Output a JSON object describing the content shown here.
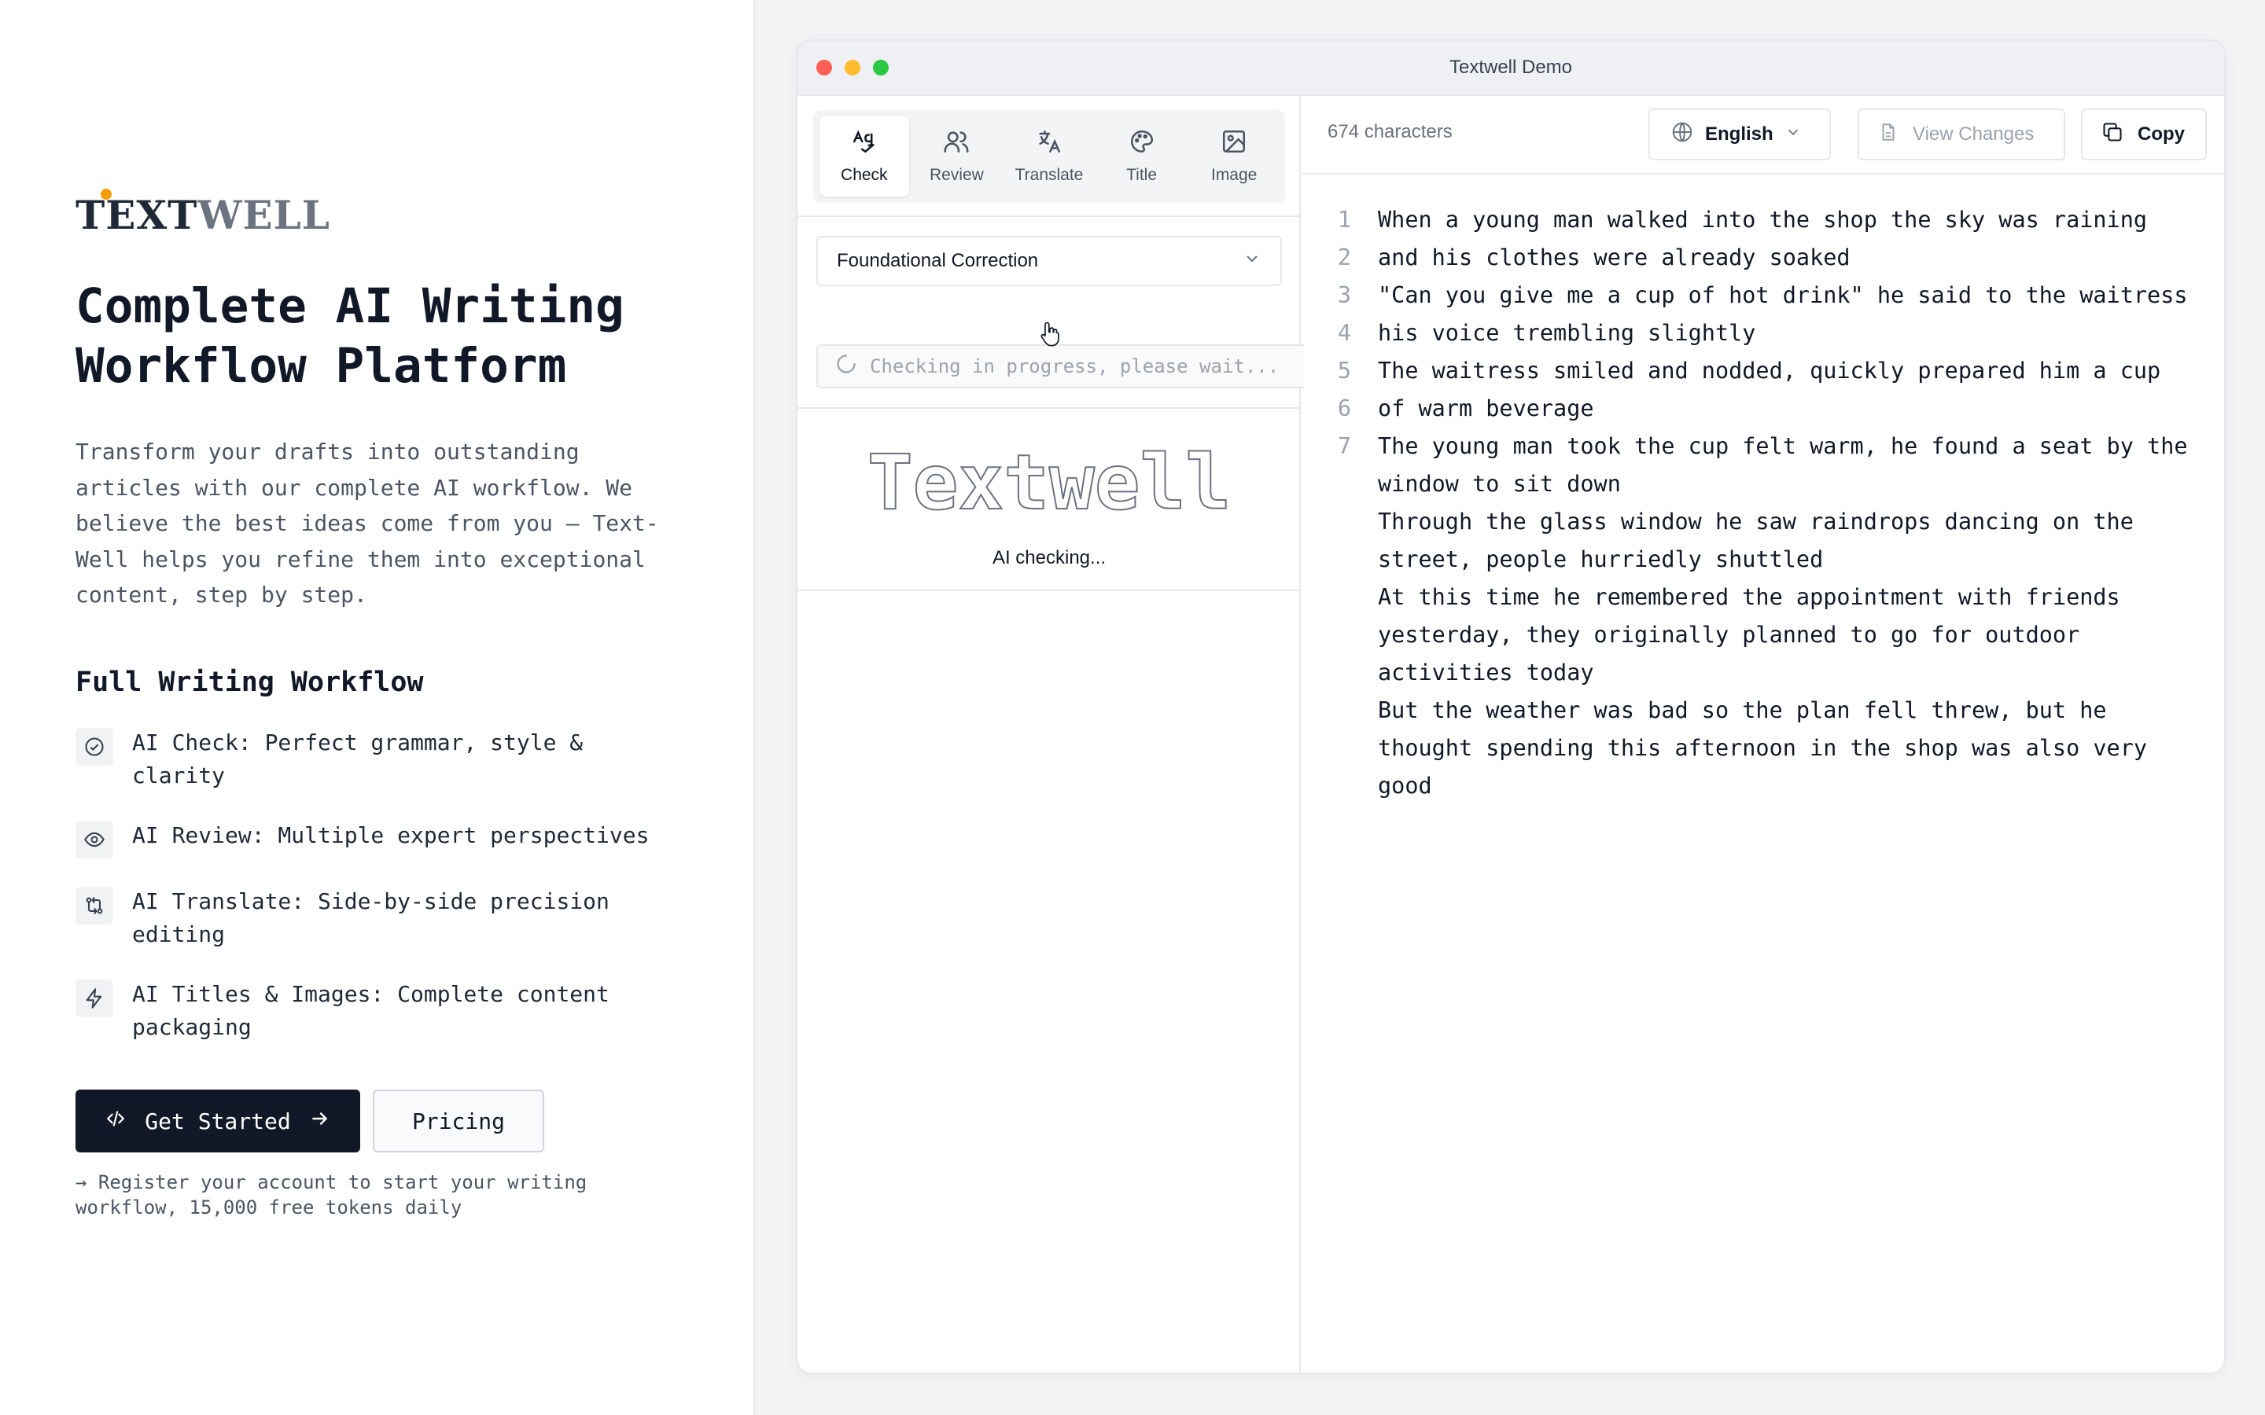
{
  "brand": {
    "logo_first": "T",
    "logo_mid": "EXT",
    "logo_last": "WELL",
    "accent_color": "#f59e0b"
  },
  "hero": {
    "title": "Complete AI Writing Workflow Platform",
    "description": "Transform your drafts into outstanding articles with our complete AI workflow. We believe the best ideas come from you – Text-Well helps you refine them into exceptional content, step by step."
  },
  "workflow": {
    "title": "Full Writing Workflow",
    "items": [
      {
        "icon": "check-circle-icon",
        "label": "AI Check: Perfect grammar, style & clarity"
      },
      {
        "icon": "eye-icon",
        "label": "AI Review: Multiple expert perspectives"
      },
      {
        "icon": "swap-icon",
        "label": "AI Translate: Side-by-side precision editing"
      },
      {
        "icon": "bolt-icon",
        "label": "AI Titles & Images: Complete content packaging"
      }
    ]
  },
  "cta": {
    "get_started": "Get Started",
    "pricing": "Pricing",
    "note": "→ Register your account to start your writing workflow, 15,000 free tokens daily"
  },
  "demo": {
    "window_title": "Textwell Demo",
    "tabs": [
      {
        "label": "Check",
        "icon": "spellcheck-icon",
        "active": true
      },
      {
        "label": "Review",
        "icon": "users-icon",
        "active": false
      },
      {
        "label": "Translate",
        "icon": "translate-icon",
        "active": false
      },
      {
        "label": "Title",
        "icon": "palette-icon",
        "active": false
      },
      {
        "label": "Image",
        "icon": "image-icon",
        "active": false
      }
    ],
    "mode": "Foundational Correction",
    "progress_text": "Checking in progress, please wait...",
    "art_text": "Textwell",
    "status": "AI checking...",
    "char_count": "674 characters",
    "language": "English",
    "view_changes": "View Changes",
    "copy": "Copy",
    "lines": [
      {
        "num": "1",
        "text": "When a young man walked into the shop the sky was raining"
      },
      {
        "num": "2",
        "text": "and his clothes were already soaked"
      },
      {
        "num": "3",
        "text": "\"Can you give me a cup of hot drink\" he said to the waitress"
      },
      {
        "num": "4",
        "text": "his voice trembling slightly"
      },
      {
        "num": "5",
        "text": "The waitress smiled and nodded, quickly prepared him a cup"
      },
      {
        "num": "6",
        "text": "of warm beverage"
      },
      {
        "num": "7",
        "text": "The young man took the cup felt warm, he found a seat by the"
      },
      {
        "num": "",
        "text": "window to sit down"
      },
      {
        "num": "",
        "text": "Through the glass window he saw raindrops dancing on the"
      },
      {
        "num": "",
        "text": "street, people hurriedly shuttled"
      },
      {
        "num": "",
        "text": "At this time he remembered the appointment with friends"
      },
      {
        "num": "",
        "text": "yesterday, they originally planned to go for outdoor"
      },
      {
        "num": "",
        "text": "activities today"
      },
      {
        "num": "",
        "text": "But the weather was bad so the plan fell threw, but he"
      },
      {
        "num": "",
        "text": "thought spending this afternoon in the shop was also very"
      },
      {
        "num": "",
        "text": "good"
      }
    ]
  }
}
